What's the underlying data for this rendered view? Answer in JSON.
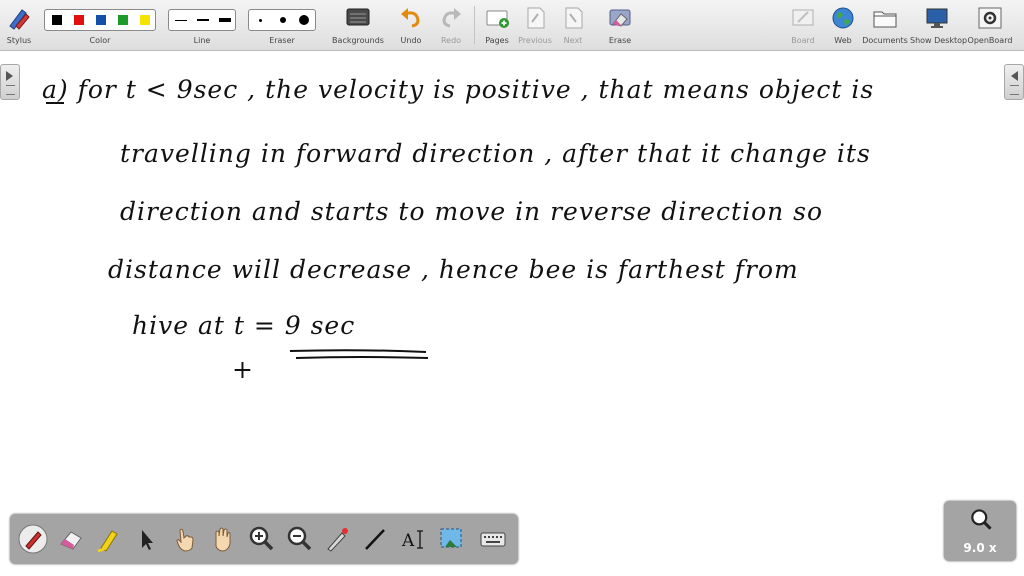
{
  "toolbar": {
    "stylus_label": "Stylus",
    "color_label": "Color",
    "line_label": "Line",
    "eraser_label": "Eraser",
    "backgrounds_label": "Backgrounds",
    "undo_label": "Undo",
    "redo_label": "Redo",
    "pages_label": "Pages",
    "previous_label": "Previous",
    "next_label": "Next",
    "erase_label": "Erase",
    "board_label": "Board",
    "web_label": "Web",
    "documents_label": "Documents",
    "show_desktop_label": "Show Desktop",
    "openboard_label": "OpenBoard",
    "colors": [
      "#000000",
      "#e01010",
      "#1550a8",
      "#1e9a2a",
      "#f4e400"
    ],
    "selected_color": "#000000"
  },
  "canvas": {
    "lines": [
      "a)   for  t < 9sec  ,  the  velocity  is positive , that means  object is",
      "travelling  in  forward  direction  , after  that  it  change  its",
      "direction  and  starts  to  move  in  reverse  direction  so",
      "distance  will decrease ,  hence  bee  is  farthest  from",
      "hive   at     t =  9 sec",
      "+"
    ]
  },
  "float_toolbar": {
    "tools": [
      "pen-icon",
      "eraser-icon",
      "marker-icon",
      "selector-icon",
      "interact-hand-icon",
      "pan-hand-icon",
      "zoom-in-icon",
      "zoom-out-icon",
      "laser-pointer-icon",
      "line-icon",
      "text-icon",
      "capture-icon",
      "virtual-keyboard-icon"
    ],
    "active_tool": "pen-icon"
  },
  "zoom": {
    "level": "9.0 x"
  }
}
